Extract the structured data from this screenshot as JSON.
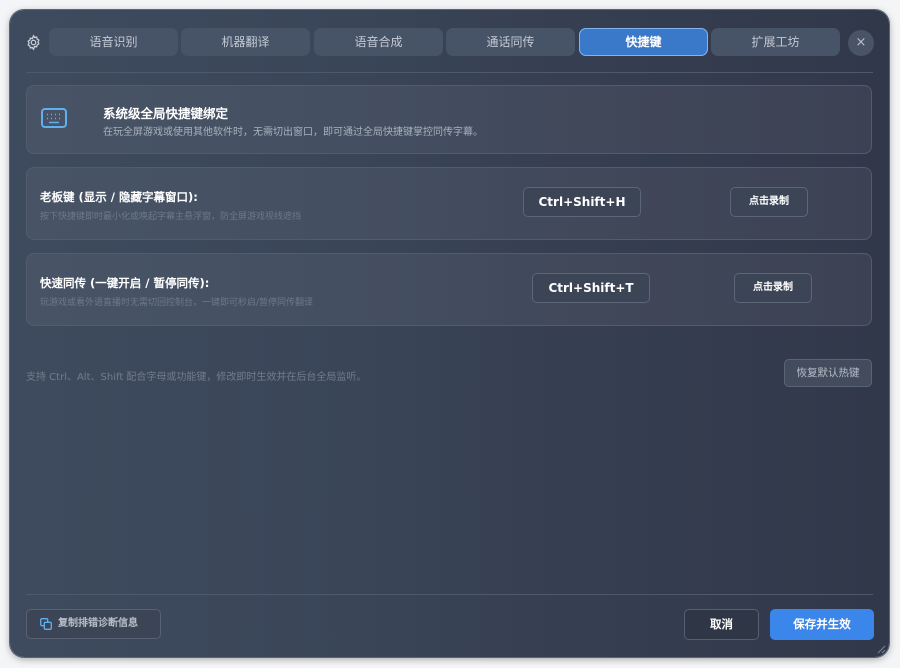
{
  "tabs": [
    {
      "label": "语音识别",
      "active": false
    },
    {
      "label": "机器翻译",
      "active": false
    },
    {
      "label": "语音合成",
      "active": false
    },
    {
      "label": "通话同传",
      "active": false
    },
    {
      "label": "快捷键",
      "active": true
    },
    {
      "label": "扩展工坊",
      "active": false
    }
  ],
  "close_label": "×",
  "info": {
    "icon": "keyboard-icon",
    "title": "系统级全局快捷键绑定",
    "desc": "在玩全屏游戏或使用其他软件时，无需切出窗口，即可通过全局快捷键掌控同传字幕。"
  },
  "hotkeys": [
    {
      "title": "老板键 (显示 / 隐藏字幕窗口):",
      "desc": "按下快捷键即时最小化或唤起字幕主悬浮窗，防全屏游戏视线遮挡",
      "keys": "Ctrl+Shift+H",
      "record_label": "点击录制"
    },
    {
      "title": "快速同传 (一键开启 / 暂停同传):",
      "desc": "玩游戏或看外语直播时无需切回控制台，一键即可秒启/暂停同传翻译",
      "keys": "Ctrl+Shift+T",
      "record_label": "点击录制"
    }
  ],
  "hint": "支持 Ctrl、Alt、Shift 配合字母或功能键，修改即时生效并在后台全局监听。",
  "reset_label": "恢复默认热键",
  "footer": {
    "copy_label": "复制排错诊断信息",
    "cancel_label": "取消",
    "save_label": "保存并生效"
  },
  "colors": {
    "accent": "#3b86ea",
    "active_tab": "#3a78c9",
    "icon_blue": "#5fb0f0"
  }
}
